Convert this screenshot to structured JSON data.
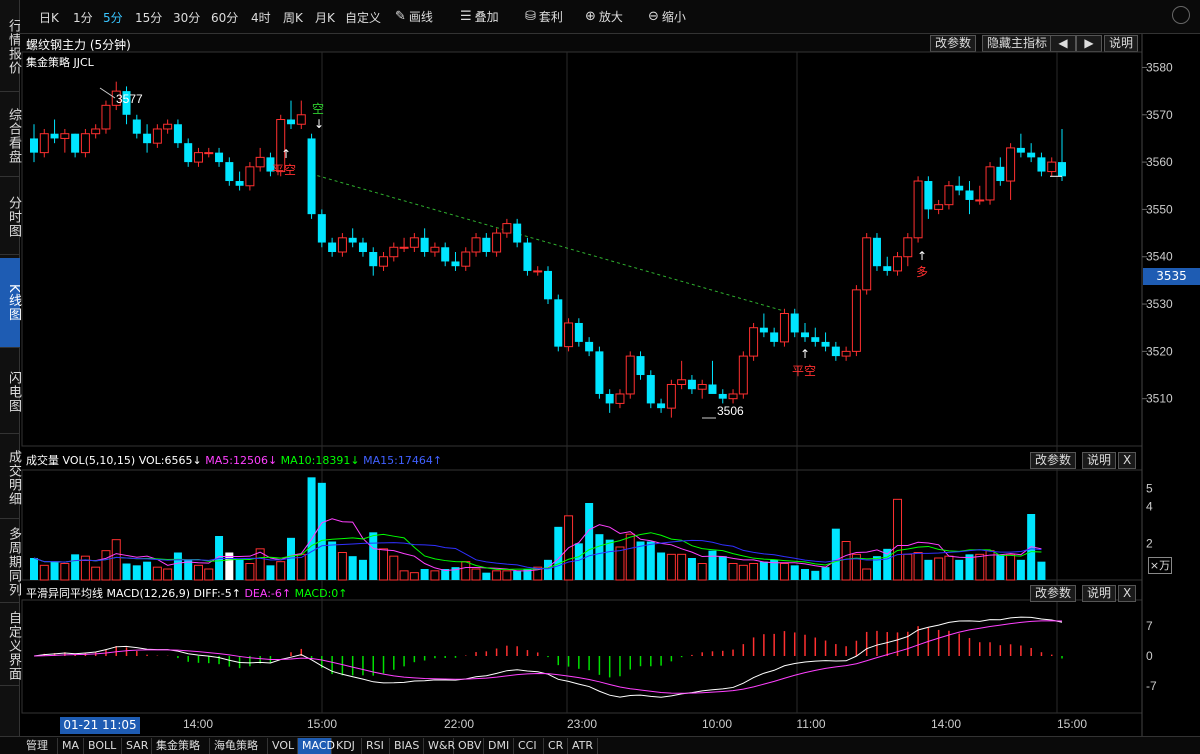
{
  "left_nav": [
    {
      "label": "行情报价",
      "active": false
    },
    {
      "label": "综合看盘",
      "active": false
    },
    {
      "label": "分时图",
      "active": false
    },
    {
      "label": "K线图",
      "active": true
    },
    {
      "label": "闪电图",
      "active": false
    },
    {
      "label": "成交明细",
      "active": false
    },
    {
      "label": "多周期同列",
      "active": false
    },
    {
      "label": "自定义界面",
      "active": false
    }
  ],
  "timeframes": [
    {
      "label": "日K",
      "active": false
    },
    {
      "label": "1分",
      "active": false
    },
    {
      "label": "5分",
      "active": true
    },
    {
      "label": "15分",
      "active": false
    },
    {
      "label": "30分",
      "active": false
    },
    {
      "label": "60分",
      "active": false
    },
    {
      "label": "4时",
      "active": false
    },
    {
      "label": "周K",
      "active": false
    },
    {
      "label": "月K",
      "active": false
    },
    {
      "label": "自定义",
      "active": false
    }
  ],
  "tools": [
    {
      "label": "画线",
      "icon": "pencil-icon"
    },
    {
      "label": "叠加",
      "icon": "stack-icon"
    },
    {
      "label": "套利",
      "icon": "arbitrage-icon"
    },
    {
      "label": "放大",
      "icon": "zoom-in-icon"
    },
    {
      "label": "缩小",
      "icon": "zoom-out-icon"
    }
  ],
  "header": {
    "title": "螺纹钢主力 (5分钟)",
    "strategy": "集金策略 JJCL",
    "change_params": "改参数",
    "hide_main": "隐藏主指标",
    "left_arrow": "◀",
    "right_arrow": "▶",
    "explain": "说明"
  },
  "price_axis": {
    "labels": [
      "3580",
      "3570",
      "3560",
      "3550",
      "3540",
      "3530",
      "3520",
      "3510"
    ],
    "current": "3535"
  },
  "annotations": {
    "high": "3577",
    "low": "3506",
    "short": "空",
    "close_short": "平空",
    "long": "多"
  },
  "volume_panel": {
    "label": "成交量",
    "vol": "VOL(5,10,15)",
    "vol_val": "VOL:6565↓",
    "ma5": "MA5:12506↓",
    "ma10": "MA10:18391↓",
    "ma15": "MA15:17464↑",
    "axis": [
      "5",
      "4",
      "2"
    ],
    "unit": "×万",
    "change_params": "改参数",
    "explain": "说明",
    "close": "X"
  },
  "macd_panel": {
    "label": "平滑异同平均线",
    "name": "MACD(12,26,9)",
    "diff": "DIFF:-5↑",
    "dea": "DEA:-6↑",
    "macd": "MACD:0↑",
    "axis": [
      "7",
      "0",
      "-7"
    ],
    "change_params": "改参数",
    "explain": "说明",
    "close": "X"
  },
  "time_axis": {
    "date": "01-21 11:05",
    "labels": [
      "14:00",
      "15:00",
      "22:00",
      "23:00",
      "10:00",
      "11:00",
      "14:00",
      "15:00"
    ]
  },
  "bottom_tabs": [
    {
      "label": "管理",
      "active": false
    },
    {
      "label": "MA",
      "active": false
    },
    {
      "label": "BOLL",
      "active": false
    },
    {
      "label": "SAR",
      "active": false
    },
    {
      "label": "集金策略",
      "active": false
    },
    {
      "label": "海龟策略",
      "active": false
    },
    {
      "label": "VOL",
      "active": false
    },
    {
      "label": "MACD",
      "active": true
    },
    {
      "label": "KDJ",
      "active": false
    },
    {
      "label": "RSI",
      "active": false
    },
    {
      "label": "BIAS",
      "active": false
    },
    {
      "label": "W&R",
      "active": false
    },
    {
      "label": "OBV",
      "active": false
    },
    {
      "label": "DMI",
      "active": false
    },
    {
      "label": "CCI",
      "active": false
    },
    {
      "label": "CR",
      "active": false
    },
    {
      "label": "ATR",
      "active": false
    }
  ],
  "colors": {
    "up": "#ff3030",
    "down": "#00e5ff",
    "accent": "#1e5cb3",
    "ma5": "#ff40ff",
    "ma10": "#00ff00",
    "ma15": "#3030ff",
    "diff": "#ffffff",
    "dea": "#ff40ff"
  },
  "chart_data": {
    "type": "candlestick",
    "ylim": [
      3500,
      3582
    ],
    "candles": [
      {
        "o": 3565,
        "h": 3568,
        "l": 3560,
        "c": 3562
      },
      {
        "o": 3562,
        "h": 3567,
        "l": 3561,
        "c": 3566
      },
      {
        "o": 3566,
        "h": 3569,
        "l": 3564,
        "c": 3565
      },
      {
        "o": 3565,
        "h": 3567,
        "l": 3562,
        "c": 3566
      },
      {
        "o": 3566,
        "h": 3566,
        "l": 3561,
        "c": 3562
      },
      {
        "o": 3562,
        "h": 3567,
        "l": 3561,
        "c": 3566
      },
      {
        "o": 3566,
        "h": 3568,
        "l": 3565,
        "c": 3567
      },
      {
        "o": 3567,
        "h": 3573,
        "l": 3566,
        "c": 3572
      },
      {
        "o": 3572,
        "h": 3577,
        "l": 3571,
        "c": 3575
      },
      {
        "o": 3575,
        "h": 3576,
        "l": 3568,
        "c": 3570
      },
      {
        "o": 3569,
        "h": 3570,
        "l": 3565,
        "c": 3566
      },
      {
        "o": 3566,
        "h": 3568,
        "l": 3562,
        "c": 3564
      },
      {
        "o": 3564,
        "h": 3568,
        "l": 3563,
        "c": 3567
      },
      {
        "o": 3567,
        "h": 3569,
        "l": 3566,
        "c": 3568
      },
      {
        "o": 3568,
        "h": 3569,
        "l": 3563,
        "c": 3564
      },
      {
        "o": 3564,
        "h": 3565,
        "l": 3559,
        "c": 3560
      },
      {
        "o": 3560,
        "h": 3563,
        "l": 3559,
        "c": 3562
      },
      {
        "o": 3562,
        "h": 3563,
        "l": 3561,
        "c": 3562
      },
      {
        "o": 3562,
        "h": 3563,
        "l": 3559,
        "c": 3560
      },
      {
        "o": 3560,
        "h": 3561,
        "l": 3555,
        "c": 3556
      },
      {
        "o": 3556,
        "h": 3558,
        "l": 3554,
        "c": 3555
      },
      {
        "o": 3555,
        "h": 3560,
        "l": 3554,
        "c": 3559
      },
      {
        "o": 3559,
        "h": 3563,
        "l": 3558,
        "c": 3561
      },
      {
        "o": 3561,
        "h": 3562,
        "l": 3557,
        "c": 3558
      },
      {
        "o": 3558,
        "h": 3570,
        "l": 3557,
        "c": 3569
      },
      {
        "o": 3569,
        "h": 3573,
        "l": 3567,
        "c": 3568
      },
      {
        "o": 3568,
        "h": 3573,
        "l": 3567,
        "c": 3570
      },
      {
        "o": 3565,
        "h": 3566,
        "l": 3548,
        "c": 3549
      },
      {
        "o": 3549,
        "h": 3550,
        "l": 3542,
        "c": 3543
      },
      {
        "o": 3543,
        "h": 3544,
        "l": 3540,
        "c": 3541
      },
      {
        "o": 3541,
        "h": 3545,
        "l": 3540,
        "c": 3544
      },
      {
        "o": 3544,
        "h": 3546,
        "l": 3542,
        "c": 3543
      },
      {
        "o": 3543,
        "h": 3544,
        "l": 3540,
        "c": 3541
      },
      {
        "o": 3541,
        "h": 3542,
        "l": 3536,
        "c": 3538
      },
      {
        "o": 3538,
        "h": 3541,
        "l": 3537,
        "c": 3540
      },
      {
        "o": 3540,
        "h": 3543,
        "l": 3539,
        "c": 3542
      },
      {
        "o": 3542,
        "h": 3544,
        "l": 3541,
        "c": 3542
      },
      {
        "o": 3542,
        "h": 3545,
        "l": 3541,
        "c": 3544
      },
      {
        "o": 3544,
        "h": 3546,
        "l": 3540,
        "c": 3541
      },
      {
        "o": 3541,
        "h": 3543,
        "l": 3540,
        "c": 3542
      },
      {
        "o": 3542,
        "h": 3543,
        "l": 3538,
        "c": 3539
      },
      {
        "o": 3539,
        "h": 3541,
        "l": 3537,
        "c": 3538
      },
      {
        "o": 3538,
        "h": 3542,
        "l": 3537,
        "c": 3541
      },
      {
        "o": 3541,
        "h": 3545,
        "l": 3540,
        "c": 3544
      },
      {
        "o": 3544,
        "h": 3545,
        "l": 3540,
        "c": 3541
      },
      {
        "o": 3541,
        "h": 3546,
        "l": 3540,
        "c": 3545
      },
      {
        "o": 3545,
        "h": 3548,
        "l": 3544,
        "c": 3547
      },
      {
        "o": 3547,
        "h": 3548,
        "l": 3542,
        "c": 3543
      },
      {
        "o": 3543,
        "h": 3544,
        "l": 3536,
        "c": 3537
      },
      {
        "o": 3537,
        "h": 3538,
        "l": 3536,
        "c": 3537
      },
      {
        "o": 3537,
        "h": 3538,
        "l": 3530,
        "c": 3531
      },
      {
        "o": 3531,
        "h": 3532,
        "l": 3520,
        "c": 3521
      },
      {
        "o": 3521,
        "h": 3527,
        "l": 3520,
        "c": 3526
      },
      {
        "o": 3526,
        "h": 3527,
        "l": 3521,
        "c": 3522
      },
      {
        "o": 3522,
        "h": 3523,
        "l": 3519,
        "c": 3520
      },
      {
        "o": 3520,
        "h": 3521,
        "l": 3510,
        "c": 3511
      },
      {
        "o": 3511,
        "h": 3512,
        "l": 3507,
        "c": 3509
      },
      {
        "o": 3509,
        "h": 3512,
        "l": 3508,
        "c": 3511
      },
      {
        "o": 3511,
        "h": 3520,
        "l": 3510,
        "c": 3519
      },
      {
        "o": 3519,
        "h": 3520,
        "l": 3514,
        "c": 3515
      },
      {
        "o": 3515,
        "h": 3516,
        "l": 3508,
        "c": 3509
      },
      {
        "o": 3509,
        "h": 3510,
        "l": 3507,
        "c": 3508
      },
      {
        "o": 3508,
        "h": 3514,
        "l": 3506,
        "c": 3513
      },
      {
        "o": 3513,
        "h": 3518,
        "l": 3512,
        "c": 3514
      },
      {
        "o": 3514,
        "h": 3515,
        "l": 3511,
        "c": 3512
      },
      {
        "o": 3512,
        "h": 3514,
        "l": 3510,
        "c": 3513
      },
      {
        "o": 3513,
        "h": 3518,
        "l": 3512,
        "c": 3511
      },
      {
        "o": 3511,
        "h": 3512,
        "l": 3509,
        "c": 3510
      },
      {
        "o": 3510,
        "h": 3512,
        "l": 3509,
        "c": 3511
      },
      {
        "o": 3511,
        "h": 3520,
        "l": 3510,
        "c": 3519
      },
      {
        "o": 3519,
        "h": 3526,
        "l": 3518,
        "c": 3525
      },
      {
        "o": 3525,
        "h": 3528,
        "l": 3523,
        "c": 3524
      },
      {
        "o": 3524,
        "h": 3525,
        "l": 3521,
        "c": 3522
      },
      {
        "o": 3522,
        "h": 3529,
        "l": 3521,
        "c": 3528
      },
      {
        "o": 3528,
        "h": 3529,
        "l": 3523,
        "c": 3524
      },
      {
        "o": 3524,
        "h": 3526,
        "l": 3522,
        "c": 3523
      },
      {
        "o": 3523,
        "h": 3525,
        "l": 3521,
        "c": 3522
      },
      {
        "o": 3522,
        "h": 3524,
        "l": 3520,
        "c": 3521
      },
      {
        "o": 3521,
        "h": 3522,
        "l": 3518,
        "c": 3519
      },
      {
        "o": 3519,
        "h": 3521,
        "l": 3518,
        "c": 3520
      },
      {
        "o": 3520,
        "h": 3534,
        "l": 3519,
        "c": 3533
      },
      {
        "o": 3533,
        "h": 3545,
        "l": 3532,
        "c": 3544
      },
      {
        "o": 3544,
        "h": 3545,
        "l": 3537,
        "c": 3538
      },
      {
        "o": 3538,
        "h": 3540,
        "l": 3536,
        "c": 3537
      },
      {
        "o": 3537,
        "h": 3541,
        "l": 3536,
        "c": 3540
      },
      {
        "o": 3540,
        "h": 3545,
        "l": 3538,
        "c": 3544
      },
      {
        "o": 3544,
        "h": 3557,
        "l": 3543,
        "c": 3556
      },
      {
        "o": 3556,
        "h": 3557,
        "l": 3548,
        "c": 3550
      },
      {
        "o": 3550,
        "h": 3552,
        "l": 3549,
        "c": 3551
      },
      {
        "o": 3551,
        "h": 3556,
        "l": 3550,
        "c": 3555
      },
      {
        "o": 3555,
        "h": 3557,
        "l": 3553,
        "c": 3554
      },
      {
        "o": 3554,
        "h": 3556,
        "l": 3549,
        "c": 3552
      },
      {
        "o": 3552,
        "h": 3555,
        "l": 3551,
        "c": 3552
      },
      {
        "o": 3552,
        "h": 3560,
        "l": 3551,
        "c": 3559
      },
      {
        "o": 3559,
        "h": 3561,
        "l": 3555,
        "c": 3556
      },
      {
        "o": 3556,
        "h": 3564,
        "l": 3552,
        "c": 3563
      },
      {
        "o": 3563,
        "h": 3566,
        "l": 3561,
        "c": 3562
      },
      {
        "o": 3562,
        "h": 3564,
        "l": 3560,
        "c": 3561
      },
      {
        "o": 3561,
        "h": 3562,
        "l": 3557,
        "c": 3558
      },
      {
        "o": 3558,
        "h": 3561,
        "l": 3557,
        "c": 3560
      },
      {
        "o": 3560,
        "h": 3567,
        "l": 3556,
        "c": 3557
      }
    ],
    "volume": [
      1.2,
      0.8,
      1.0,
      0.9,
      1.4,
      1.3,
      0.7,
      1.6,
      2.2,
      0.9,
      0.8,
      1.0,
      0.7,
      0.6,
      1.5,
      1.1,
      0.8,
      0.6,
      2.4,
      1.5,
      1.1,
      0.9,
      1.7,
      0.8,
      1.0,
      2.3,
      1.4,
      5.6,
      5.3,
      2.1,
      1.5,
      1.3,
      1.1,
      2.6,
      1.7,
      1.3,
      0.5,
      0.4,
      0.6,
      0.5,
      0.6,
      0.7,
      1.0,
      0.6,
      0.4,
      0.5,
      0.5,
      0.5,
      0.6,
      0.7,
      1.1,
      2.9,
      3.5,
      2.0,
      4.2,
      2.5,
      2.2,
      1.8,
      2.5,
      2.1,
      2.1,
      1.5,
      1.4,
      1.4,
      1.2,
      0.9,
      1.6,
      1.3,
      0.9,
      0.8,
      0.9,
      1.0,
      1.1,
      0.9,
      0.8,
      0.6,
      0.5,
      0.7,
      2.8,
      2.1,
      1.4,
      0.6,
      1.3,
      1.7,
      4.4,
      1.4,
      1.5,
      1.1,
      1.2,
      1.3,
      1.1,
      1.4,
      1.4,
      1.6,
      1.4,
      1.4,
      1.1,
      3.6,
      1.0
    ]
  }
}
